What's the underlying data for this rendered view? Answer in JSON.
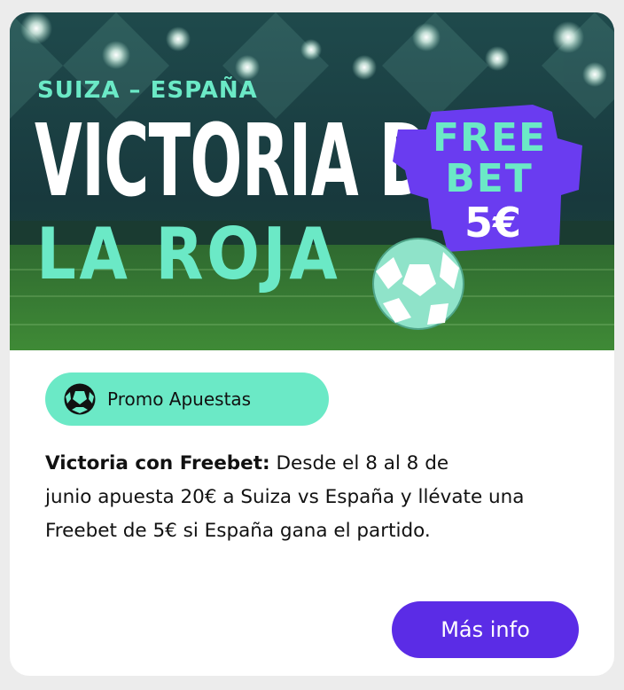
{
  "banner": {
    "subtitle": "SUIZA – ESPAÑA",
    "title_line1": "VICTORIA DE",
    "title_line2": "LA ROJA",
    "ticket_free": "FREE",
    "ticket_bet": "BET",
    "ticket_amount": "5€"
  },
  "badge": {
    "icon": "soccer-ball-icon",
    "label": "Promo Apuestas"
  },
  "description": {
    "bold_lead": "Victoria con Freebet:",
    "line1_rest": " Desde el 8 al 8 de",
    "line2": "junio apuesta 20€ a Suiza vs España y llévate una",
    "line3": "Freebet de 5€ si España gana el partido."
  },
  "cta": {
    "label": "Más info"
  },
  "colors": {
    "accent_mint": "#6be9c6",
    "button_purple": "#5b2ce6",
    "ticket_purple": "#6a3cf0",
    "pitch_green": "#2e7a2c"
  }
}
